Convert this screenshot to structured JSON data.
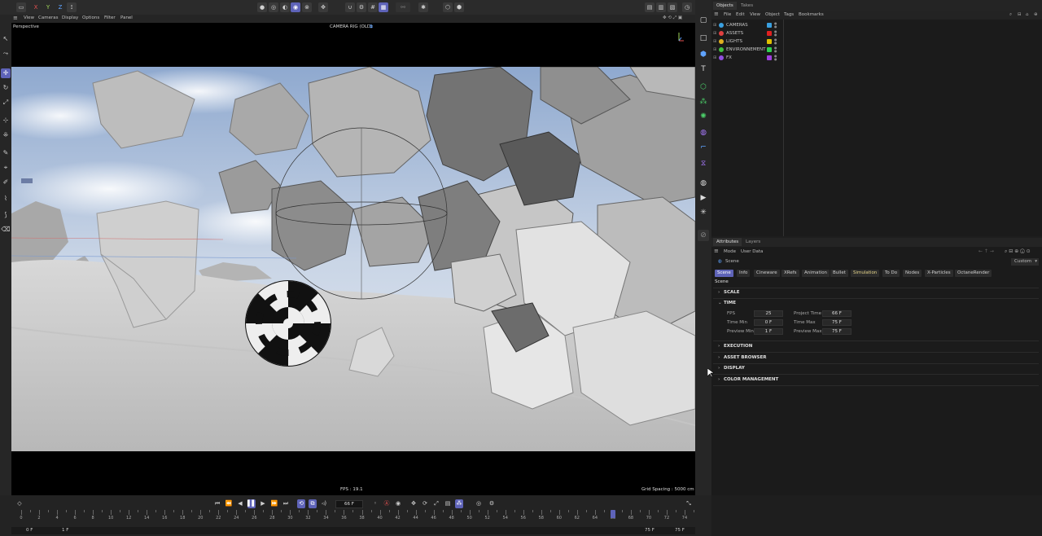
{
  "top_toolbar": {
    "view_menu": [
      "View",
      "Cameras",
      "Display",
      "Options",
      "Filter",
      "Panel"
    ],
    "axes": [
      "X",
      "Y",
      "Z"
    ]
  },
  "viewport": {
    "camera_name": "Perspective",
    "camera_rig": "CAMERA RIG (OLD)",
    "fps_readout": "FPS : 19.1",
    "grid_spacing": "Grid Spacing : 5000 cm"
  },
  "objects_panel": {
    "tabs": [
      "Objects",
      "Takes"
    ],
    "menu": [
      "File",
      "Edit",
      "View",
      "Object",
      "Tags",
      "Bookmarks"
    ],
    "items": [
      {
        "label": "CAMERAS",
        "null_color": "#3aa0e0",
        "tag_color": "#3aa0e0"
      },
      {
        "label": "ASSETS",
        "null_color": "#e04040",
        "tag_color": "#e02020"
      },
      {
        "label": "LIGHTS",
        "null_color": "#e0b020",
        "tag_color": "#e0c000"
      },
      {
        "label": "ENVIRONNEMENT",
        "null_color": "#40c040",
        "tag_color": "#30d050"
      },
      {
        "label": "FX",
        "null_color": "#9050e0",
        "tag_color": "#a040e0"
      }
    ]
  },
  "attributes_panel": {
    "tabs": [
      "Attributes",
      "Layers"
    ],
    "menu": [
      "Mode",
      "User Data"
    ],
    "object_name": "Scene",
    "preset": "Custom",
    "section_tabs": [
      "Scene",
      "Info",
      "Cineware",
      "XRefs",
      "Animation",
      "Bullet",
      "Simulation",
      "To Do",
      "Nodes",
      "X-Particles",
      "OctaneRender"
    ],
    "active_section_tab": "Scene",
    "heading": "Scene",
    "sections": {
      "scale": "SCALE",
      "time": "TIME",
      "execution": "EXECUTION",
      "asset_browser": "ASSET BROWSER",
      "display": "DISPLAY",
      "color_management": "COLOR MANAGEMENT"
    },
    "time_fields": {
      "fps_label": "FPS",
      "fps_value": "25",
      "project_time_label": "Project Time",
      "project_time_value": "66 F",
      "time_min_label": "Time Min",
      "time_min_value": "0 F",
      "time_max_label": "Time Max",
      "time_max_value": "75 F",
      "preview_min_label": "Preview Min",
      "preview_min_value": "1 F",
      "preview_max_label": "Preview Max",
      "preview_max_value": "75 F"
    }
  },
  "timeline": {
    "current_frame": "66 F",
    "ticks": [
      "0",
      "2",
      "4",
      "6",
      "8",
      "10",
      "12",
      "14",
      "16",
      "18",
      "20",
      "22",
      "24",
      "26",
      "28",
      "30",
      "32",
      "34",
      "36",
      "38",
      "40",
      "42",
      "44",
      "46",
      "48",
      "50",
      "52",
      "54",
      "56",
      "58",
      "60",
      "62",
      "64",
      "66",
      "68",
      "70",
      "72",
      "74"
    ],
    "playhead_frame": 66,
    "range_start": "0 F",
    "preview_start": "1 F",
    "preview_end": "75 F",
    "range_end": "75 F"
  }
}
